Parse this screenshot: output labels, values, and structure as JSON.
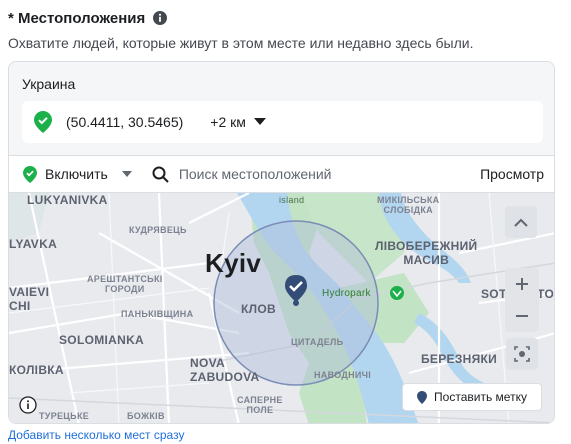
{
  "header": {
    "title": "* Местоположения",
    "subtitle": "Охватите людей, которые живут в этом месте или недавно здесь были."
  },
  "location": {
    "country": "Украина",
    "coordinates": "(50.4411, 30.5465)",
    "radius": "+2 км"
  },
  "toolbar": {
    "include_label": "Включить",
    "search_placeholder": "Поиск местоположений",
    "browse_label": "Просмотр"
  },
  "map": {
    "city": "Kyiv",
    "labels": {
      "lukyanivka": "LUKYANIVKA",
      "kudryavets": "КУДРЯВЕЦЬ",
      "ilyavka": "LYAVKA",
      "arsenal": "АРЕШТАНТСЬКІ\nГОРОДИ",
      "vaievi": "VAIEVI\nCHI",
      "pankivshchyna": "ПАНЬКІВЩИНА",
      "solomianka": "SOLOMIANKA",
      "kolivka": "КОЛІВКА",
      "nova_zabudova": "NOVA\nZABUDOVA",
      "klov": "КЛОВ",
      "tsytadel": "ЦИТАДЕЛЬ",
      "navodnychi": "НАВОДНИЧІ",
      "saperne_pole": "САПЕРНЕ\nПОЛЕ",
      "turetske": "ТУРЕЦЬКЕ",
      "bozhkiv": "БОЖКІВ",
      "island": "island",
      "mykilska": "МИКІЛЬСЬКА\nСЛОБІДКА",
      "livoberezhnyi": "ЛІВОБЕРЕЖНИЙ\nМАСИВ",
      "hydropark": "Hydropark",
      "sotsmisto": "SOTSMISTO",
      "bereznyaky": "БЕРЕЗНЯКИ"
    },
    "drop_pin_label": "Поставить метку"
  },
  "footer": {
    "add_multiple": "Добавить несколько мест сразу"
  },
  "colors": {
    "accent_green": "#1bb04a",
    "pin_navy": "#344d78",
    "link_blue": "#216fdb",
    "water": "#b2d6f0",
    "park": "#bfe1c1",
    "radius_fill": "#b0bcd6"
  },
  "icons": {
    "info": "info-icon",
    "location_pin": "location-pin-icon",
    "search": "search-icon",
    "zoom_in": "plus-icon",
    "zoom_out": "minus-icon",
    "recenter": "crosshair-icon",
    "collapse": "chevron-up-icon"
  }
}
